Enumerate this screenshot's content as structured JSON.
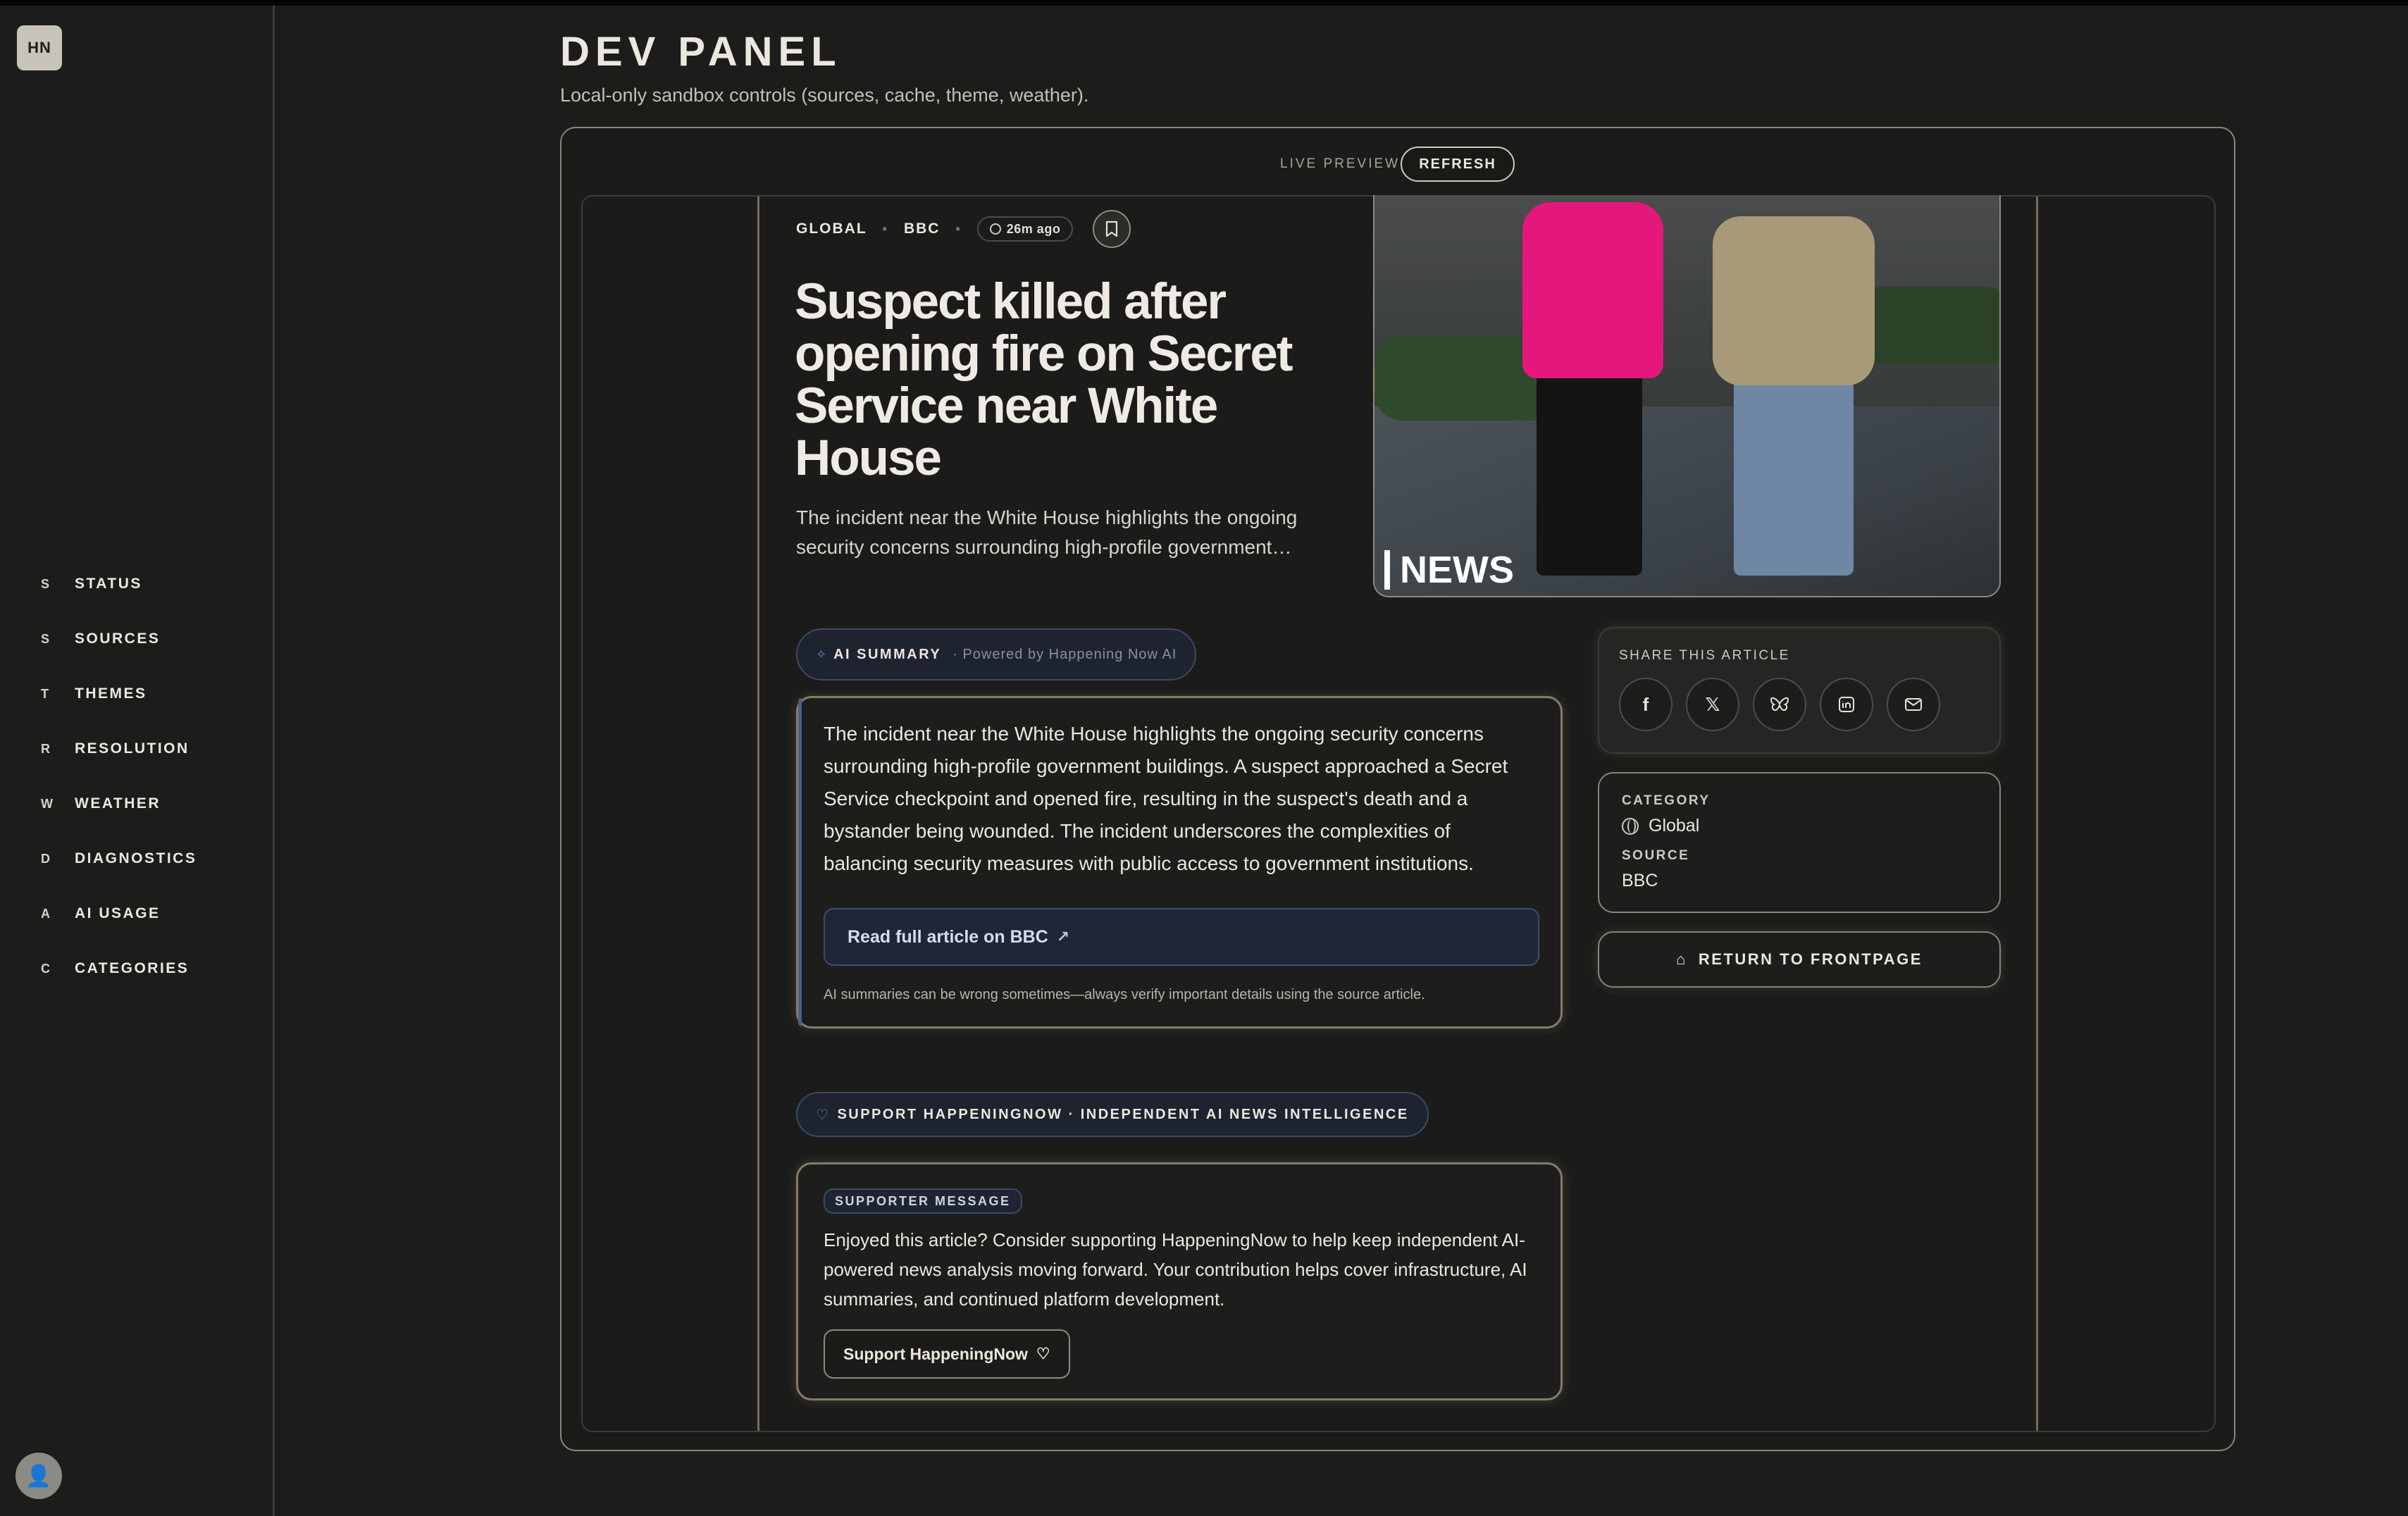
{
  "sidebar": {
    "logo": "HN",
    "items": [
      {
        "key": "S",
        "label": "STATUS"
      },
      {
        "key": "S",
        "label": "SOURCES"
      },
      {
        "key": "T",
        "label": "THEMES"
      },
      {
        "key": "R",
        "label": "RESOLUTION"
      },
      {
        "key": "W",
        "label": "WEATHER"
      },
      {
        "key": "D",
        "label": "DIAGNOSTICS"
      },
      {
        "key": "A",
        "label": "AI USAGE"
      },
      {
        "key": "C",
        "label": "CATEGORIES"
      }
    ],
    "avatar_icon": "user-avatar-icon"
  },
  "header": {
    "title": "DEV PANEL",
    "subtitle": "Local-only sandbox controls (sources, cache, theme, weather)."
  },
  "preview": {
    "label": "LIVE PREVIEW",
    "refresh_label": "REFRESH"
  },
  "article": {
    "category": "GLOBAL",
    "source": "BBC",
    "time": "26m ago",
    "headline": "Suspect killed after opening fire on Secret Service near White House",
    "dek": "The incident near the White House highlights the ongoing security concerns surrounding high-profile government…",
    "image_watermark": "NEWS"
  },
  "ai_summary": {
    "title": "AI SUMMARY",
    "powered_by": "Powered by Happening Now AI",
    "text": "The incident near the White House highlights the ongoing security concerns surrounding high-profile government buildings. A suspect approached a Secret Service checkpoint and opened fire, resulting in the suspect's death and a bystander being wounded. The incident underscores the complexities of balancing security measures with public access to government institutions.",
    "read_full": "Read full article on BBC",
    "disclaimer": "AI summaries can be wrong sometimes—always verify important details using the source article."
  },
  "share": {
    "label": "SHARE THIS ARTICLE",
    "icons": [
      "facebook-icon",
      "x-icon",
      "bluesky-icon",
      "linkedin-icon",
      "email-icon"
    ]
  },
  "meta_card": {
    "category_label": "CATEGORY",
    "category_value": "Global",
    "source_label": "SOURCE",
    "source_value": "BBC"
  },
  "return_label": "RETURN TO FRONTPAGE",
  "support": {
    "pill": "SUPPORT HAPPENINGNOW · INDEPENDENT AI NEWS INTELLIGENCE",
    "badge": "SUPPORTER MESSAGE",
    "text": "Enjoyed this article? Consider supporting HappeningNow to help keep independent AI-powered news analysis moving forward. Your contribution helps cover infrastructure, AI summaries, and continued platform development.",
    "button": "Support HappeningNow"
  }
}
